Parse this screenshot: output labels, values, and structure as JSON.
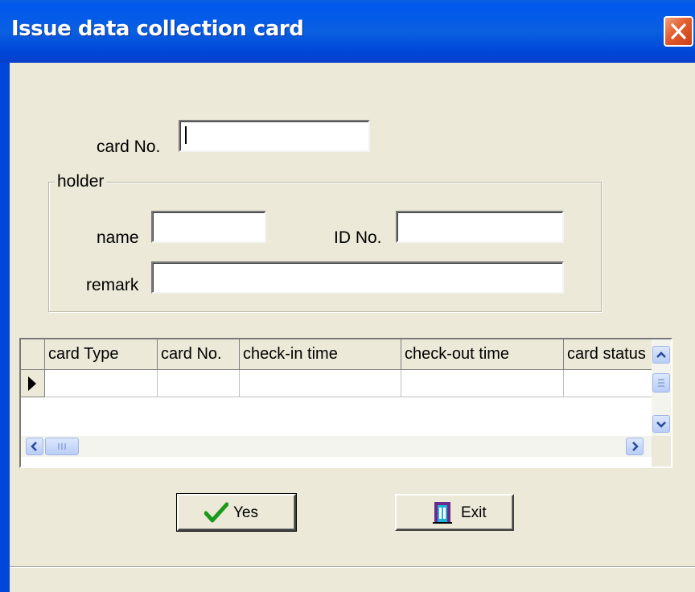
{
  "window": {
    "title": "Issue data collection card"
  },
  "form": {
    "card_no_label": "card No.",
    "card_no_value": "",
    "holder_group_label": "holder",
    "name_label": "name",
    "name_value": "",
    "id_no_label": "ID No.",
    "id_no_value": "",
    "remark_label": "remark",
    "remark_value": ""
  },
  "grid": {
    "columns": [
      "card Type",
      "card No.",
      "check-in time",
      "check-out time",
      "card status"
    ],
    "rows": [
      [
        "",
        "",
        "",
        "",
        ""
      ]
    ]
  },
  "buttons": {
    "yes_label": "Yes",
    "exit_label": "Exit"
  },
  "icons": {
    "close": "close-icon",
    "yes": "checkmark-icon",
    "exit": "exit-door-icon"
  },
  "colors": {
    "titlebar": "#0a5fe0",
    "close_button": "#e35c2e",
    "checkmark": "#1a9a1a",
    "window_face": "#ece9d8"
  }
}
